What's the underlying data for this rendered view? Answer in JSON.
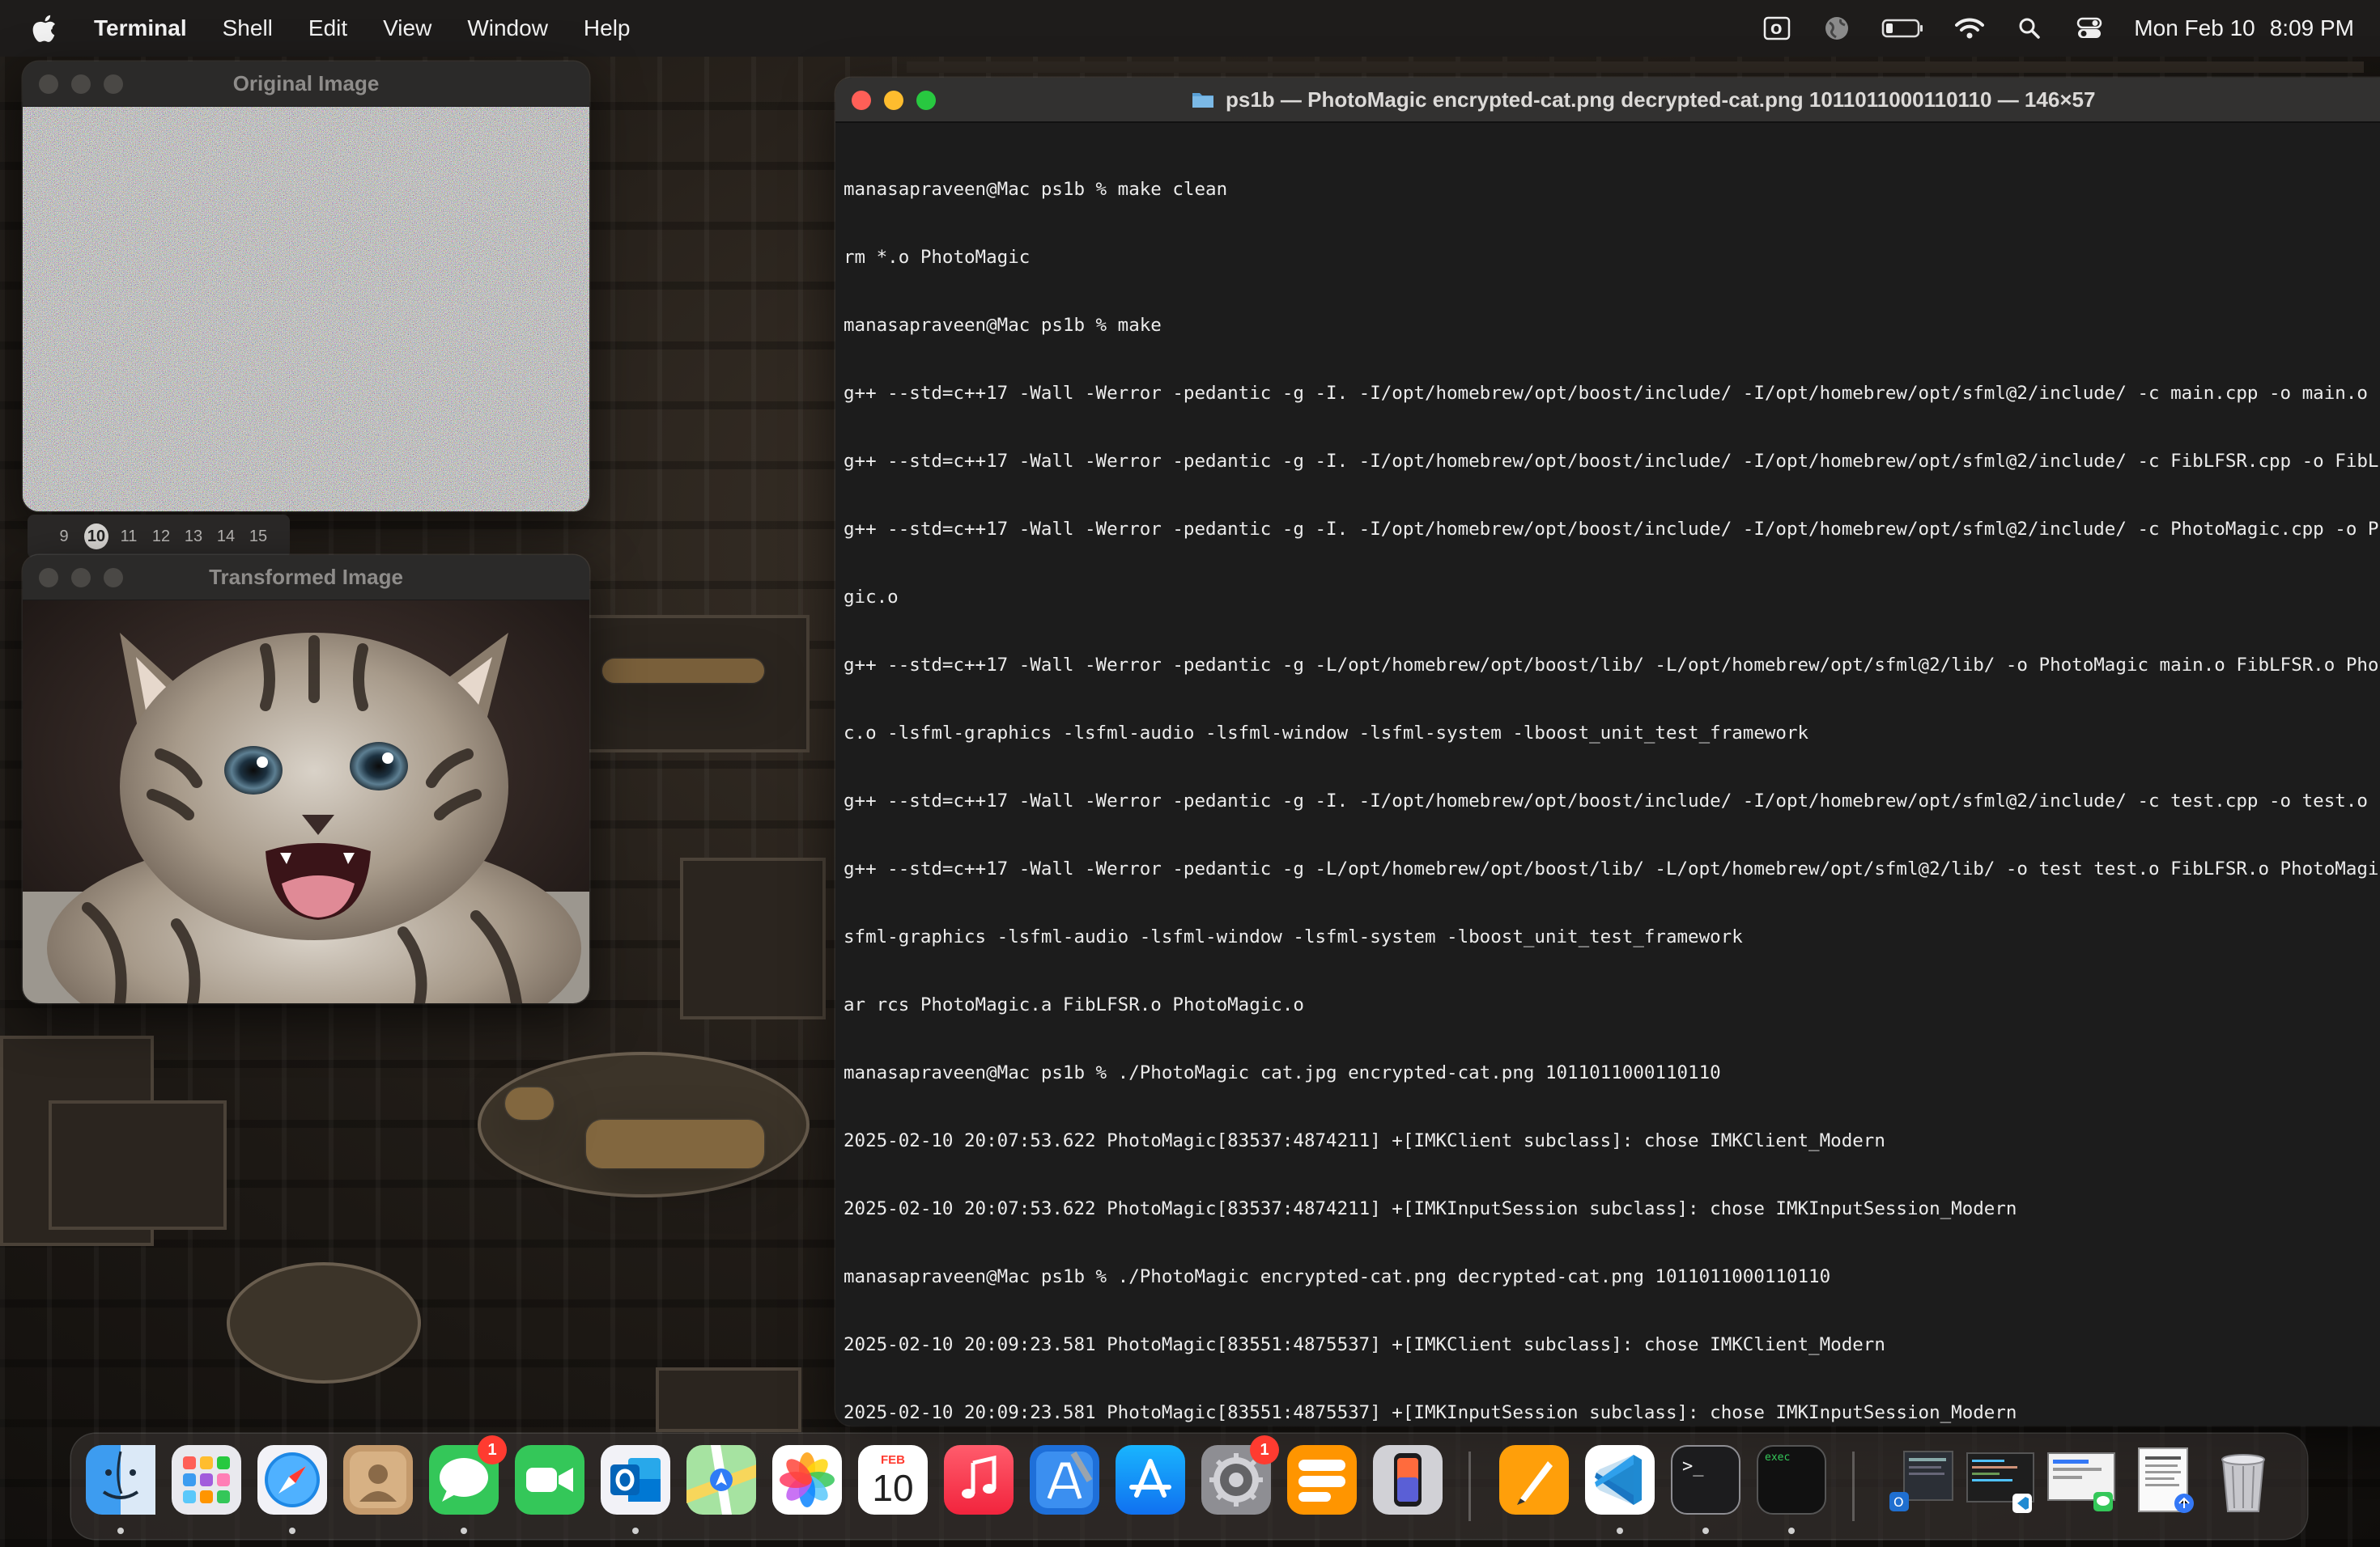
{
  "menubar": {
    "app_name": "Terminal",
    "items": [
      "Shell",
      "Edit",
      "View",
      "Window",
      "Help"
    ],
    "status_icons": [
      "outlook-icon",
      "globe-icon",
      "battery-icon",
      "wifi-icon",
      "search-icon",
      "control-center-icon"
    ],
    "date": "Mon Feb 10",
    "time": "8:09 PM"
  },
  "original_window": {
    "title": "Original Image"
  },
  "transformed_window": {
    "title": "Transformed Image"
  },
  "space_tabs": [
    "9",
    "10",
    "11",
    "12",
    "13",
    "14",
    "15"
  ],
  "space_tab_selected": "10",
  "terminal": {
    "title": "ps1b — PhotoMagic encrypted-cat.png decrypted-cat.png 1011011000110110 — 146×57",
    "lines": [
      "manasapraveen@Mac ps1b % make clean",
      "rm *.o PhotoMagic",
      "manasapraveen@Mac ps1b % make",
      "g++ --std=c++17 -Wall -Werror -pedantic -g -I. -I/opt/homebrew/opt/boost/include/ -I/opt/homebrew/opt/sfml@2/include/ -c main.cpp -o main.o",
      "g++ --std=c++17 -Wall -Werror -pedantic -g -I. -I/opt/homebrew/opt/boost/include/ -I/opt/homebrew/opt/sfml@2/include/ -c FibLFSR.cpp -o FibLFSR.o",
      "g++ --std=c++17 -Wall -Werror -pedantic -g -I. -I/opt/homebrew/opt/boost/include/ -I/opt/homebrew/opt/sfml@2/include/ -c PhotoMagic.cpp -o PhotoMa",
      "gic.o",
      "g++ --std=c++17 -Wall -Werror -pedantic -g -L/opt/homebrew/opt/boost/lib/ -L/opt/homebrew/opt/sfml@2/lib/ -o PhotoMagic main.o FibLFSR.o PhotoMagi",
      "c.o -lsfml-graphics -lsfml-audio -lsfml-window -lsfml-system -lboost_unit_test_framework",
      "g++ --std=c++17 -Wall -Werror -pedantic -g -I. -I/opt/homebrew/opt/boost/include/ -I/opt/homebrew/opt/sfml@2/include/ -c test.cpp -o test.o",
      "g++ --std=c++17 -Wall -Werror -pedantic -g -L/opt/homebrew/opt/boost/lib/ -L/opt/homebrew/opt/sfml@2/lib/ -o test test.o FibLFSR.o PhotoMagic.o -l",
      "sfml-graphics -lsfml-audio -lsfml-window -lsfml-system -lboost_unit_test_framework",
      "ar rcs PhotoMagic.a FibLFSR.o PhotoMagic.o",
      "manasapraveen@Mac ps1b % ./PhotoMagic cat.jpg encrypted-cat.png 1011011000110110",
      "2025-02-10 20:07:53.622 PhotoMagic[83537:4874211] +[IMKClient subclass]: chose IMKClient_Modern",
      "2025-02-10 20:07:53.622 PhotoMagic[83537:4874211] +[IMKInputSession subclass]: chose IMKInputSession_Modern",
      "manasapraveen@Mac ps1b % ./PhotoMagic encrypted-cat.png decrypted-cat.png 1011011000110110",
      "2025-02-10 20:09:23.581 PhotoMagic[83551:4875537] +[IMKClient subclass]: chose IMKClient_Modern",
      "2025-02-10 20:09:23.581 PhotoMagic[83551:4875537] +[IMKInputSession subclass]: chose IMKInputSession_Modern"
    ]
  },
  "dock": {
    "apps": [
      {
        "name": "finder-icon",
        "running": true
      },
      {
        "name": "launchpad-icon",
        "running": false
      },
      {
        "name": "safari-icon",
        "running": true
      },
      {
        "name": "contacts-icon",
        "running": false
      },
      {
        "name": "messages-icon",
        "running": true,
        "badge": "1"
      },
      {
        "name": "facetime-icon",
        "running": false
      },
      {
        "name": "outlook-icon",
        "running": true
      },
      {
        "name": "maps-icon",
        "running": false
      },
      {
        "name": "photos-icon",
        "running": false
      },
      {
        "name": "calendar-icon",
        "running": false,
        "month": "FEB",
        "day": "10"
      },
      {
        "name": "music-icon",
        "running": false
      },
      {
        "name": "xcode-icon",
        "running": false
      },
      {
        "name": "app-store-icon",
        "running": false
      },
      {
        "name": "system-settings-icon",
        "running": false,
        "badge": "1"
      },
      {
        "name": "reminders-icon",
        "running": false
      },
      {
        "name": "iphone-mirroring-icon",
        "running": false
      },
      {
        "name": "pages-icon",
        "running": false
      },
      {
        "name": "vscode-icon",
        "running": true
      },
      {
        "name": "terminal-icon",
        "running": true,
        "label": ">_"
      },
      {
        "name": "exec-icon",
        "running": true,
        "label": "exec"
      },
      {
        "name": "recent-outlook-window-icon",
        "running": false
      },
      {
        "name": "recent-vscode-window-icon",
        "running": false
      },
      {
        "name": "recent-messages-window-icon",
        "running": false
      },
      {
        "name": "recent-document-icon",
        "running": false
      },
      {
        "name": "trash-icon",
        "running": false
      }
    ]
  }
}
